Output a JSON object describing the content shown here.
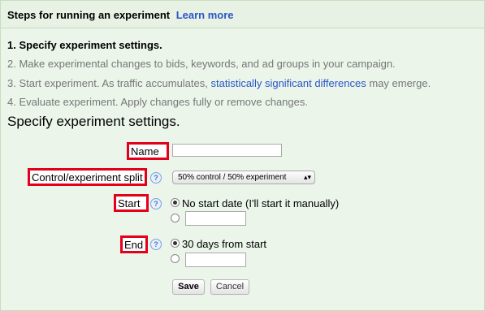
{
  "header": {
    "title": "Steps for running an experiment",
    "learn_more": "Learn more"
  },
  "steps": {
    "s1": "1. Specify experiment settings.",
    "s2": "2. Make experimental changes to bids, keywords, and ad groups in your campaign.",
    "s3_pre": "3. Start experiment. As traffic accumulates, ",
    "s3_link": "statistically significant differences",
    "s3_post": " may emerge.",
    "s4": "4. Evaluate experiment. Apply changes fully or remove changes."
  },
  "section_title": "Specify experiment settings.",
  "form": {
    "name_label": "Name",
    "name_value": "",
    "split_label": "Control/experiment split",
    "split_value": "50% control / 50% experiment",
    "start_label": "Start",
    "start_option_1": "No start date (I'll start it manually)",
    "start_option_2_value": "",
    "end_label": "End",
    "end_option_1": "30 days from start",
    "end_option_2_value": "",
    "help_glyph": "?",
    "save": "Save",
    "cancel": "Cancel"
  },
  "colors": {
    "background": "#ebf5ea",
    "highlight_border": "#e3001b",
    "link": "#2a56c6"
  },
  "icons": [
    "help-icon",
    "dropdown-arrows-icon"
  ]
}
